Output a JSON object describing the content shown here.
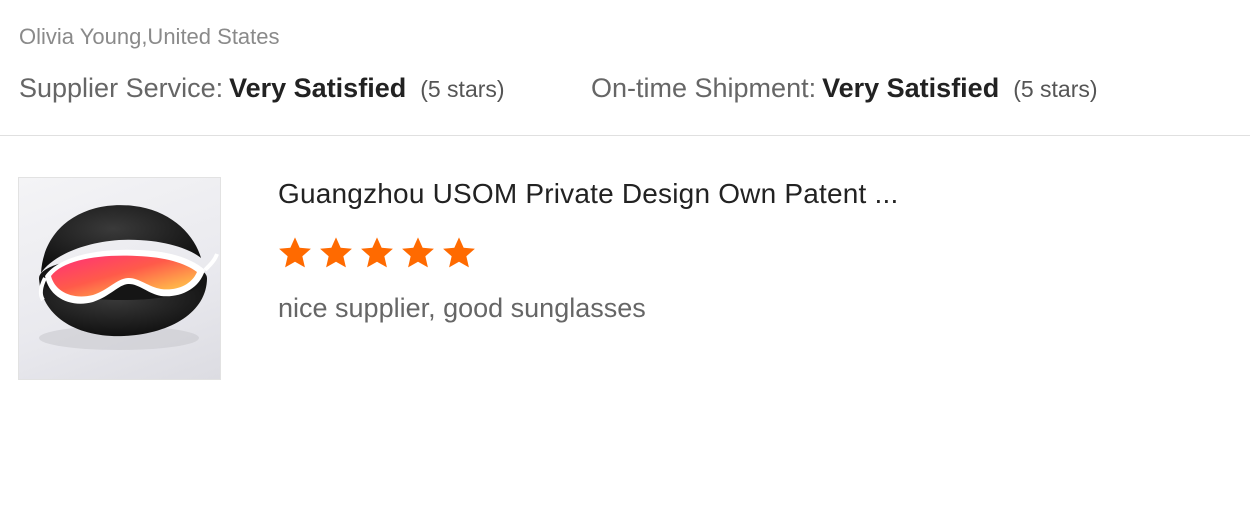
{
  "review": {
    "reviewer": "Olivia Young,United States",
    "ratings": [
      {
        "label": "Supplier Service:",
        "value": "Very Satisfied",
        "stars_text": "(5 stars)"
      },
      {
        "label": "On-time Shipment:",
        "value": "Very Satisfied",
        "stars_text": "(5 stars)"
      }
    ]
  },
  "product": {
    "image_icon": "sunglasses-product-photo",
    "title": "Guangzhou USOM Private Design Own Patent ...",
    "rating": 5,
    "rating_max": 5,
    "comment": "nice supplier, good sunglasses"
  },
  "colors": {
    "star": "#ff6a00",
    "label": "#666666",
    "value": "#222222",
    "reviewer": "#8a8a8a"
  }
}
